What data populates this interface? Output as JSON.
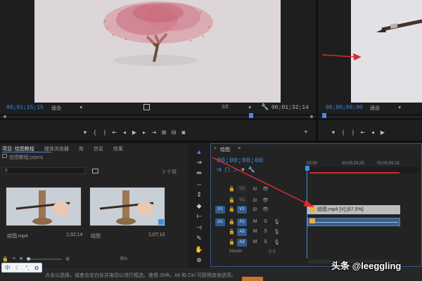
{
  "source_monitor": {
    "timecode_in": "00;01;15;15",
    "fit_label": "适合",
    "resolution": "1/2",
    "timecode_duration": "00;01;32;14"
  },
  "program_monitor": {
    "timecode": "00;00;00;00",
    "fit_label": "适合"
  },
  "project_panel": {
    "tabs": [
      "项目: 绘图教程",
      "媒体浏览器",
      "库",
      "信息",
      "效果"
    ],
    "project_file": "绘图教程.prproj",
    "search_placeholder": "",
    "item_count": "2 个项",
    "items": [
      {
        "name": "绘图.mp4",
        "duration": "1;32;14"
      },
      {
        "name": "绘图",
        "duration": "1;07;10"
      }
    ],
    "bin_label": "Bin"
  },
  "timeline": {
    "tab_title": "绘图",
    "timecode": "00;00;00;00",
    "ruler": [
      "00;00",
      "00;00;29;29",
      "00;00;59;28"
    ],
    "video_tracks": [
      {
        "label": "V3",
        "source": ""
      },
      {
        "label": "V2",
        "source": ""
      },
      {
        "label": "V1",
        "source": "V1"
      }
    ],
    "audio_tracks": [
      {
        "label": "A1",
        "source": "A1"
      },
      {
        "label": "A2",
        "source": ""
      },
      {
        "label": "A3",
        "source": ""
      }
    ],
    "clip_label": "绘图.mp4 [V] [67.5%]",
    "master_value": "0.0"
  },
  "status_bar": {
    "text": "点击以选择，或者击空白处并拖动以进行框选。使用 Shift、Alt 和 Ctrl 可获得其他选项。"
  },
  "ime": {
    "mode_label": "中"
  },
  "watermark": {
    "text": "头条 @leeggling"
  },
  "colors": {
    "accent_blue": "#3d8ee6",
    "annotation_red": "#e3262b"
  }
}
